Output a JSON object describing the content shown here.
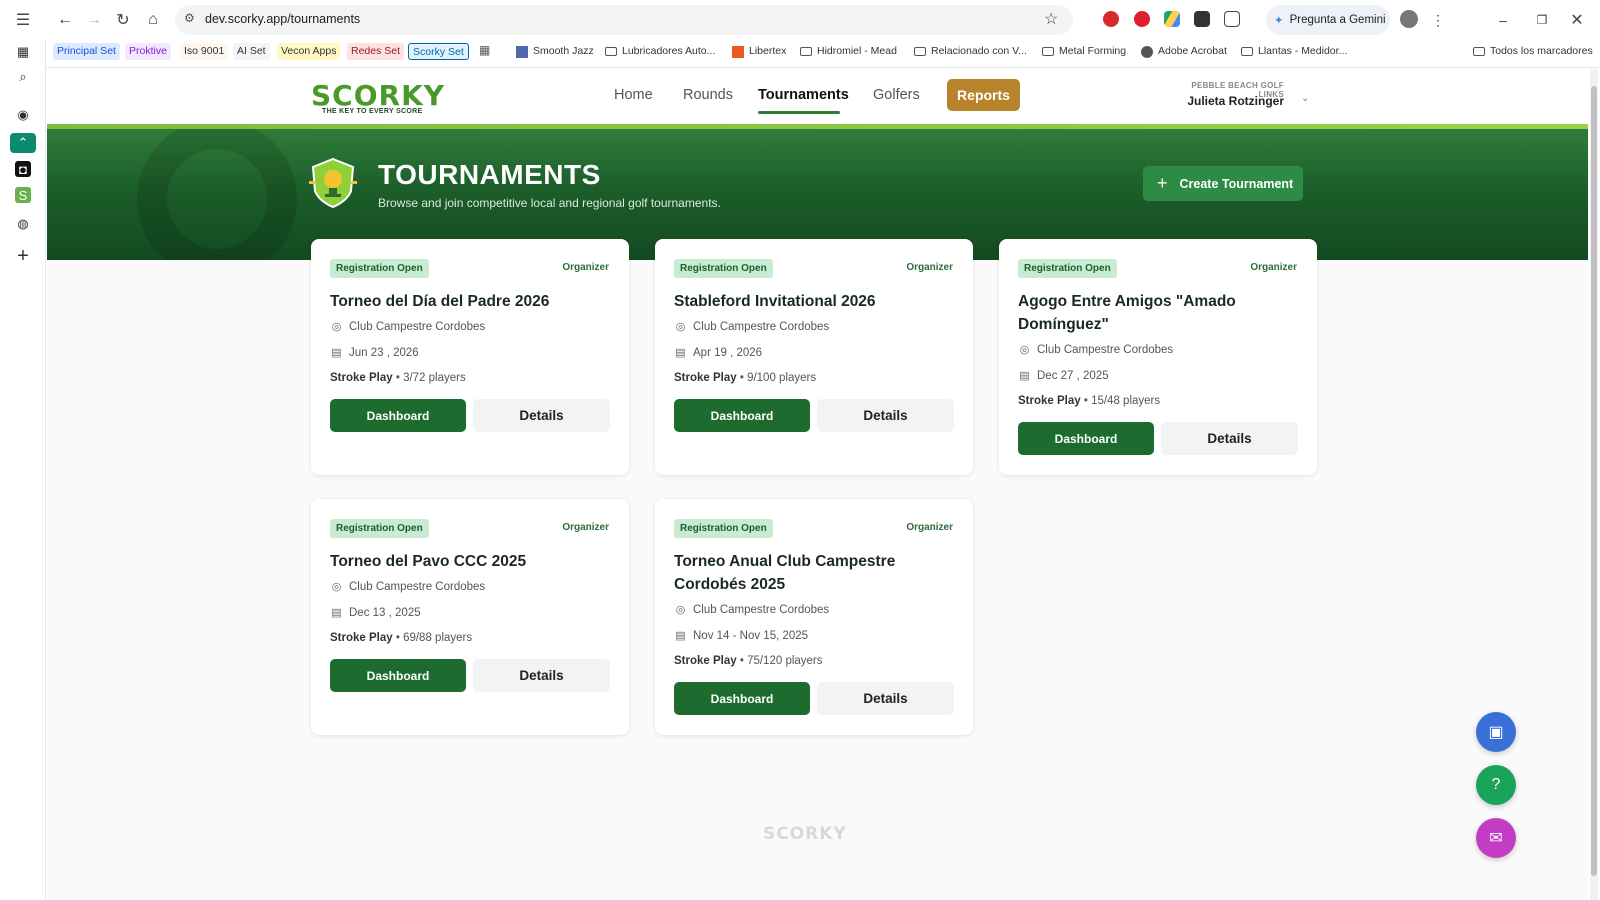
{
  "browser": {
    "url": "dev.scorky.app/tournaments",
    "gemini_label": "Pregunta a Gemini",
    "bookmarks": [
      {
        "label": "Principal Set",
        "type": "chip",
        "color": "#dbeafe",
        "text_color": "#1d4ed8"
      },
      {
        "label": "Proktive",
        "type": "chip",
        "color": "#f3e8ff",
        "text_color": "#7e22ce"
      },
      {
        "label": "Iso 9001",
        "type": "chip",
        "color": "#fff7ed",
        "text_color": "#333333"
      },
      {
        "label": "AI Set",
        "type": "chip",
        "color": "#f5f5f5",
        "text_color": "#333333"
      },
      {
        "label": "Vecon Apps",
        "type": "chip",
        "color": "#fef9c3",
        "text_color": "#333333"
      },
      {
        "label": "Redes Set",
        "type": "chip",
        "color": "#fee2e2",
        "text_color": "#991b1b"
      },
      {
        "label": "Scorky Set",
        "type": "chip",
        "color": "#e0f2fe",
        "text_color": "#0369a1"
      },
      {
        "label": "Smooth Jazz",
        "type": "item"
      },
      {
        "label": "Lubricadores Auto...",
        "type": "folder"
      },
      {
        "label": "Libertex",
        "type": "item"
      },
      {
        "label": "Hidromiel - Mead",
        "type": "folder"
      },
      {
        "label": "Relacionado con V...",
        "type": "folder"
      },
      {
        "label": "Metal Forming",
        "type": "folder"
      },
      {
        "label": "Adobe Acrobat",
        "type": "item"
      },
      {
        "label": "Llantas - Medidor...",
        "type": "folder"
      },
      {
        "label": "Todos los marcadores",
        "type": "folder"
      }
    ]
  },
  "app": {
    "logo": "SCORKY",
    "logo_tagline": "THE KEY TO EVERY SCORE",
    "nav": [
      "Home",
      "Rounds",
      "Tournaments",
      "Golfers"
    ],
    "nav_active": "Tournaments",
    "reports_label": "Reports",
    "course_name": "PEBBLE BEACH GOLF LINKS",
    "user_name": "Julieta Rotzinger",
    "colors": {
      "brand_green": "#1e6b30",
      "accent_gold": "#b8842b",
      "badge_bg": "#c8ecd2"
    }
  },
  "hero": {
    "title": "TOURNAMENTS",
    "subtitle": "Browse and join competitive local and regional golf tournaments.",
    "create_label": "Create Tournament"
  },
  "tournaments": [
    {
      "status": "Registration Open",
      "role": "Organizer",
      "title": "Torneo del Día del Padre 2026",
      "venue": "Club Campestre Cordobes",
      "date": "Jun 23 , 2026",
      "format": "Stroke Play",
      "players": " • 3/72 players",
      "dashboard": "Dashboard",
      "details": "Details"
    },
    {
      "status": "Registration Open",
      "role": "Organizer",
      "title": "Stableford Invitational 2026",
      "venue": "Club Campestre Cordobes",
      "date": "Apr 19 , 2026",
      "format": "Stroke Play",
      "players": " • 9/100 players",
      "dashboard": "Dashboard",
      "details": "Details"
    },
    {
      "status": "Registration Open",
      "role": "Organizer",
      "title": "Agogo Entre Amigos \"Amado Domínguez\"",
      "venue": "Club Campestre Cordobes",
      "date": "Dec 27 , 2025",
      "format": "Stroke Play",
      "players": " • 15/48 players",
      "dashboard": "Dashboard",
      "details": "Details"
    },
    {
      "status": "Registration Open",
      "role": "Organizer",
      "title": "Torneo del Pavo CCC 2025",
      "venue": "Club Campestre Cordobes",
      "date": "Dec 13 , 2025",
      "format": "Stroke Play",
      "players": " • 69/88 players",
      "dashboard": "Dashboard",
      "details": "Details"
    },
    {
      "status": "Registration Open",
      "role": "Organizer",
      "title": "Torneo Anual Club Campestre Cordobés 2025",
      "venue": "Club Campestre Cordobes",
      "date": "Nov 14 - Nov 15, 2025",
      "format": "Stroke Play",
      "players": " • 75/120 players",
      "dashboard": "Dashboard",
      "details": "Details"
    }
  ],
  "footer": {
    "logo": "SCORKY"
  },
  "fabs": [
    {
      "name": "video-call",
      "color": "#3b6fd8"
    },
    {
      "name": "help",
      "color": "#1aa35a"
    },
    {
      "name": "chat",
      "color": "#c53cc4"
    }
  ]
}
